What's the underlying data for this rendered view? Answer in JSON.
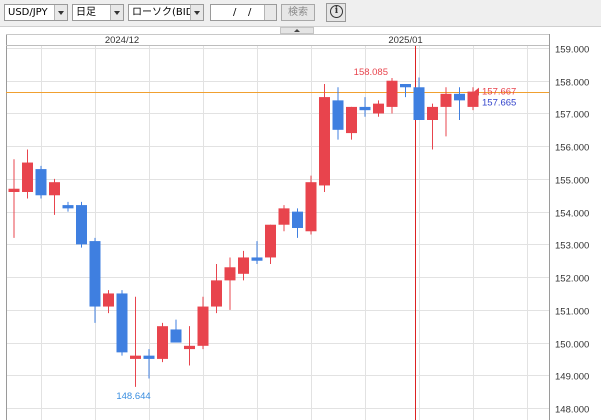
{
  "toolbar": {
    "pair": "USD/JPY",
    "period": "日足",
    "chart_kind": "ローソク(BID)",
    "date_sep1": "/",
    "date_sep2": "/",
    "search_label": "検索"
  },
  "colors": {
    "up": "#e8444d",
    "down": "#3f7fe0",
    "grid": "#e2e2e2",
    "hline": "#f0a030",
    "vline": "#dd2222",
    "bid_marker": "#e8444d",
    "ask_marker": "#3344cc",
    "low_label": "#3a8ee0",
    "high_label": "#e8444d"
  },
  "chart_data": {
    "type": "candlestick",
    "title": "",
    "ylim": [
      148.0,
      159.0
    ],
    "y_ticks": [
      "148.000",
      "149.000",
      "150.000",
      "151.000",
      "152.000",
      "153.000",
      "154.000",
      "155.000",
      "156.000",
      "157.000",
      "158.000",
      "159.000"
    ],
    "x_labels": [
      {
        "text": "2024/12",
        "at": 8
      },
      {
        "text": "2025/01",
        "at": 29
      }
    ],
    "grid": true,
    "candles": [
      {
        "o": 154.6,
        "h": 155.6,
        "l": 153.2,
        "c": 154.7
      },
      {
        "o": 154.6,
        "h": 155.9,
        "l": 154.4,
        "c": 155.5
      },
      {
        "o": 155.3,
        "h": 155.4,
        "l": 154.4,
        "c": 154.5
      },
      {
        "o": 154.5,
        "h": 155.0,
        "l": 153.9,
        "c": 154.9
      },
      {
        "o": 154.2,
        "h": 154.3,
        "l": 154.0,
        "c": 154.1
      },
      {
        "o": 154.2,
        "h": 154.3,
        "l": 152.9,
        "c": 153.0
      },
      {
        "o": 153.1,
        "h": 153.2,
        "l": 150.6,
        "c": 151.1
      },
      {
        "o": 151.1,
        "h": 151.6,
        "l": 150.9,
        "c": 151.5
      },
      {
        "o": 151.5,
        "h": 151.6,
        "l": 149.6,
        "c": 149.7
      },
      {
        "o": 149.5,
        "h": 151.4,
        "l": 148.644,
        "c": 149.6
      },
      {
        "o": 149.6,
        "h": 149.8,
        "l": 148.9,
        "c": 149.5
      },
      {
        "o": 149.5,
        "h": 150.6,
        "l": 149.4,
        "c": 150.5
      },
      {
        "o": 150.4,
        "h": 150.7,
        "l": 150.0,
        "c": 150.0
      },
      {
        "o": 149.8,
        "h": 150.5,
        "l": 149.3,
        "c": 149.9
      },
      {
        "o": 149.9,
        "h": 151.4,
        "l": 149.8,
        "c": 151.1
      },
      {
        "o": 151.1,
        "h": 152.4,
        "l": 150.9,
        "c": 151.9
      },
      {
        "o": 151.9,
        "h": 152.6,
        "l": 151.0,
        "c": 152.3
      },
      {
        "o": 152.1,
        "h": 152.8,
        "l": 151.9,
        "c": 152.6
      },
      {
        "o": 152.6,
        "h": 153.1,
        "l": 152.4,
        "c": 152.5
      },
      {
        "o": 152.6,
        "h": 153.6,
        "l": 152.4,
        "c": 153.6
      },
      {
        "o": 153.6,
        "h": 154.2,
        "l": 153.4,
        "c": 154.1
      },
      {
        "o": 154.0,
        "h": 154.1,
        "l": 153.2,
        "c": 153.5
      },
      {
        "o": 153.4,
        "h": 155.1,
        "l": 153.3,
        "c": 154.9
      },
      {
        "o": 154.8,
        "h": 157.9,
        "l": 154.6,
        "c": 157.5
      },
      {
        "o": 157.4,
        "h": 157.8,
        "l": 156.2,
        "c": 156.5
      },
      {
        "o": 156.4,
        "h": 157.2,
        "l": 156.2,
        "c": 157.2
      },
      {
        "o": 157.2,
        "h": 157.5,
        "l": 156.9,
        "c": 157.1
      },
      {
        "o": 157.0,
        "h": 157.4,
        "l": 156.9,
        "c": 157.3
      },
      {
        "o": 157.2,
        "h": 158.085,
        "l": 157.0,
        "c": 158.0
      },
      {
        "o": 157.9,
        "h": 157.8,
        "l": 157.5,
        "c": 157.8
      },
      {
        "o": 157.8,
        "h": 158.1,
        "l": 156.9,
        "c": 156.8
      },
      {
        "o": 156.8,
        "h": 157.3,
        "l": 155.9,
        "c": 157.2
      },
      {
        "o": 157.2,
        "h": 157.8,
        "l": 156.3,
        "c": 157.6
      },
      {
        "o": 157.6,
        "h": 157.8,
        "l": 156.8,
        "c": 157.4
      },
      {
        "o": 157.2,
        "h": 157.8,
        "l": 157.1,
        "c": 157.667
      }
    ],
    "annotations": {
      "high": {
        "text": "158.085",
        "value": 158.085,
        "index": 28
      },
      "low": {
        "text": "148.644",
        "value": 148.644,
        "index": 9
      }
    },
    "hline": 157.667,
    "vline_index": 29.7,
    "current": {
      "bid": "157.667",
      "ask": "157.665",
      "bid_value": 157.667,
      "ask_value": 157.665
    }
  }
}
